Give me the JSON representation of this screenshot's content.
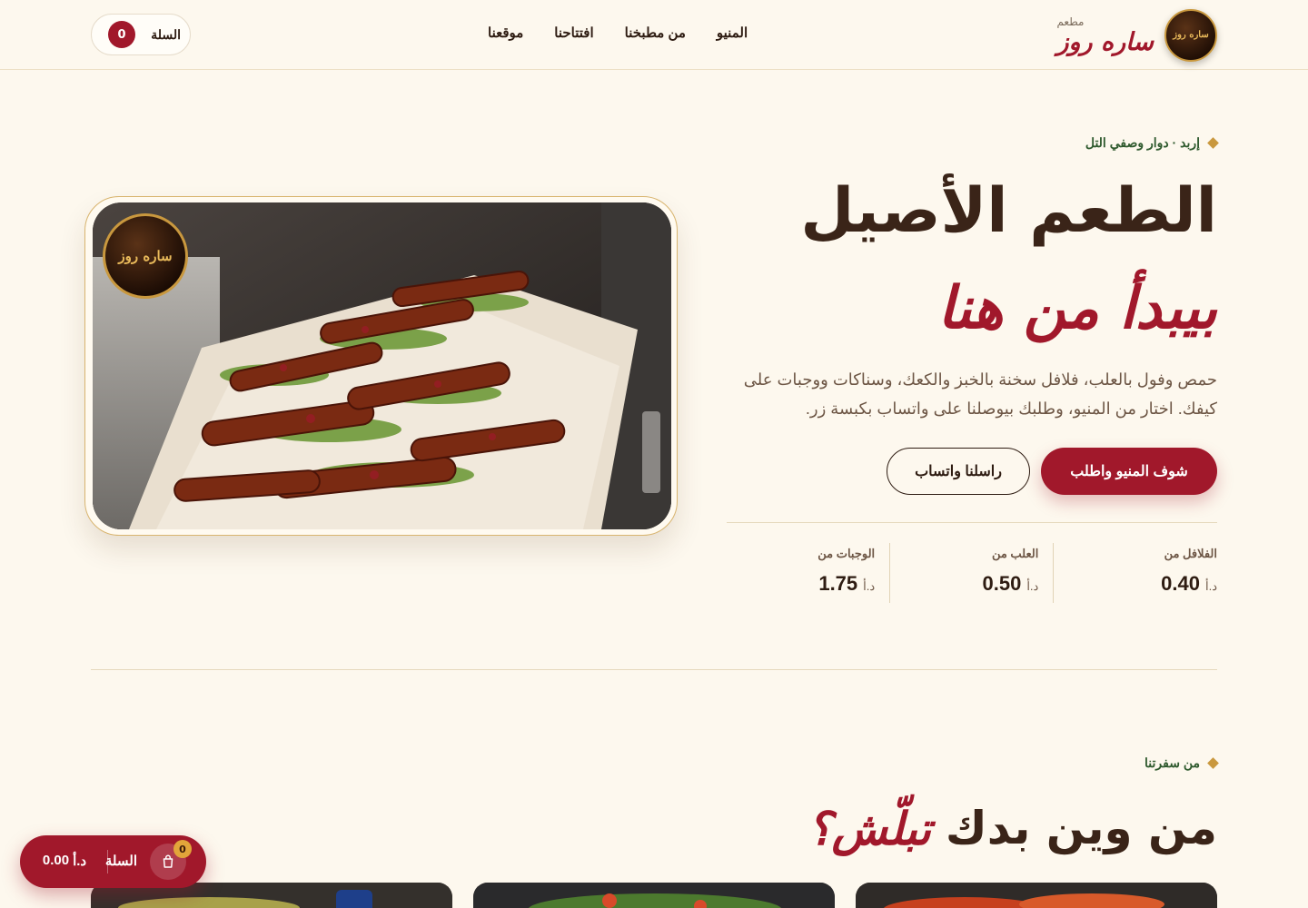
{
  "header": {
    "brand_small": "مطعم",
    "brand_name": "ساره روز",
    "nav": [
      {
        "label": "المنيو"
      },
      {
        "label": "من مطبخنا"
      },
      {
        "label": "افتتاحنا"
      },
      {
        "label": "موقعنا"
      }
    ],
    "cart_label": "السلة",
    "cart_count": "0"
  },
  "hero": {
    "eyebrow": "إربد · دوار وصفي التل",
    "title": "الطعم الأصيل",
    "script": "بيبدأ من هنا",
    "description": "حمص وفول بالعلب، فلافل سخنة بالخبز والكعك، وسناكات ووجبات على كيفك. اختار من المنيو، وطلبك بيوصلنا على واتساب بكبسة زر.",
    "primary_button": "شوف المنيو واطلب",
    "secondary_button": "راسلنا واتساب",
    "stats": [
      {
        "label": "الفلافل من",
        "currency": "د.أ",
        "value": "0.40"
      },
      {
        "label": "العلب من",
        "currency": "د.أ",
        "value": "0.50"
      },
      {
        "label": "الوجبات من",
        "currency": "د.أ",
        "value": "1.75"
      }
    ],
    "image_badge": "ساره روز"
  },
  "section": {
    "eyebrow": "من سفرتنا",
    "title_plain": "من وين بدك",
    "title_script": "تبلّش؟"
  },
  "floating_cart": {
    "label": "السلة",
    "count": "0",
    "total": "0.00",
    "currency": "د.أ"
  },
  "colors": {
    "background": "#fdf8ee",
    "brand_red": "#a1182b",
    "gold": "#c9983e",
    "text_dark": "#3a2418",
    "eyebrow_green": "#2f5a2e"
  }
}
